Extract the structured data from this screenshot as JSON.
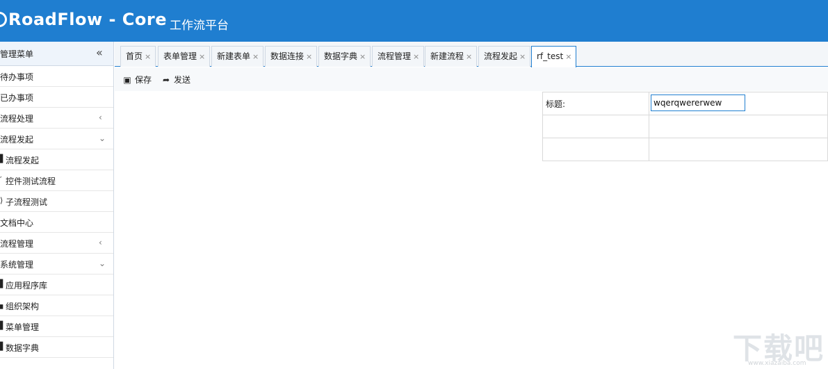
{
  "header": {
    "brand": "RoadFlow - Core",
    "subtitle": "工作流平台"
  },
  "sidebar": {
    "title": "管理菜单",
    "collapse_icon": "double-chevron-left-icon",
    "items": [
      {
        "label": "待办事项",
        "arrow": "",
        "type": "top"
      },
      {
        "label": "已办事项",
        "arrow": "",
        "type": "top"
      },
      {
        "label": "流程处理",
        "arrow": "‹",
        "type": "top"
      },
      {
        "label": "流程发起",
        "arrow": "⌄",
        "type": "top"
      },
      {
        "label": "流程发起",
        "arrow": "",
        "type": "sub",
        "icon": "▌"
      },
      {
        "label": "控件测试流程",
        "arrow": "",
        "type": "sub",
        "icon": "′"
      },
      {
        "label": "子流程测试",
        "arrow": "",
        "type": "sub",
        "icon": "⟩"
      },
      {
        "label": "文档中心",
        "arrow": "",
        "type": "top"
      },
      {
        "label": "流程管理",
        "arrow": "‹",
        "type": "top"
      },
      {
        "label": "系统管理",
        "arrow": "⌄",
        "type": "top"
      },
      {
        "label": "应用程序库",
        "arrow": "",
        "type": "sub",
        "icon": "▌"
      },
      {
        "label": "组织架构",
        "arrow": "",
        "type": "sub",
        "icon": "▖"
      },
      {
        "label": "菜单管理",
        "arrow": "",
        "type": "sub",
        "icon": "▌"
      },
      {
        "label": "数据字典",
        "arrow": "",
        "type": "sub",
        "icon": "▌"
      }
    ]
  },
  "tabs": [
    {
      "label": "首页",
      "close": "×"
    },
    {
      "label": "表单管理",
      "close": "×"
    },
    {
      "label": "新建表单",
      "close": "×"
    },
    {
      "label": "数据连接",
      "close": "×"
    },
    {
      "label": "数据字典",
      "close": "×"
    },
    {
      "label": "流程管理",
      "close": "×"
    },
    {
      "label": "新建流程",
      "close": "×"
    },
    {
      "label": "流程发起",
      "close": "×"
    },
    {
      "label": "rf_test",
      "close": "×",
      "active": true
    }
  ],
  "toolbar": {
    "save_label": "保存",
    "save_icon": "floppy-disk-icon",
    "send_label": "发送",
    "send_icon": "share-arrow-icon"
  },
  "form": {
    "title_label": "标题:",
    "title_value": "wqerqwererwew"
  },
  "watermark": {
    "text": "下载吧",
    "url": "www.xiazaiba.com"
  },
  "colors": {
    "header": "#1f7ed0",
    "active_border": "#1f7ed0"
  }
}
